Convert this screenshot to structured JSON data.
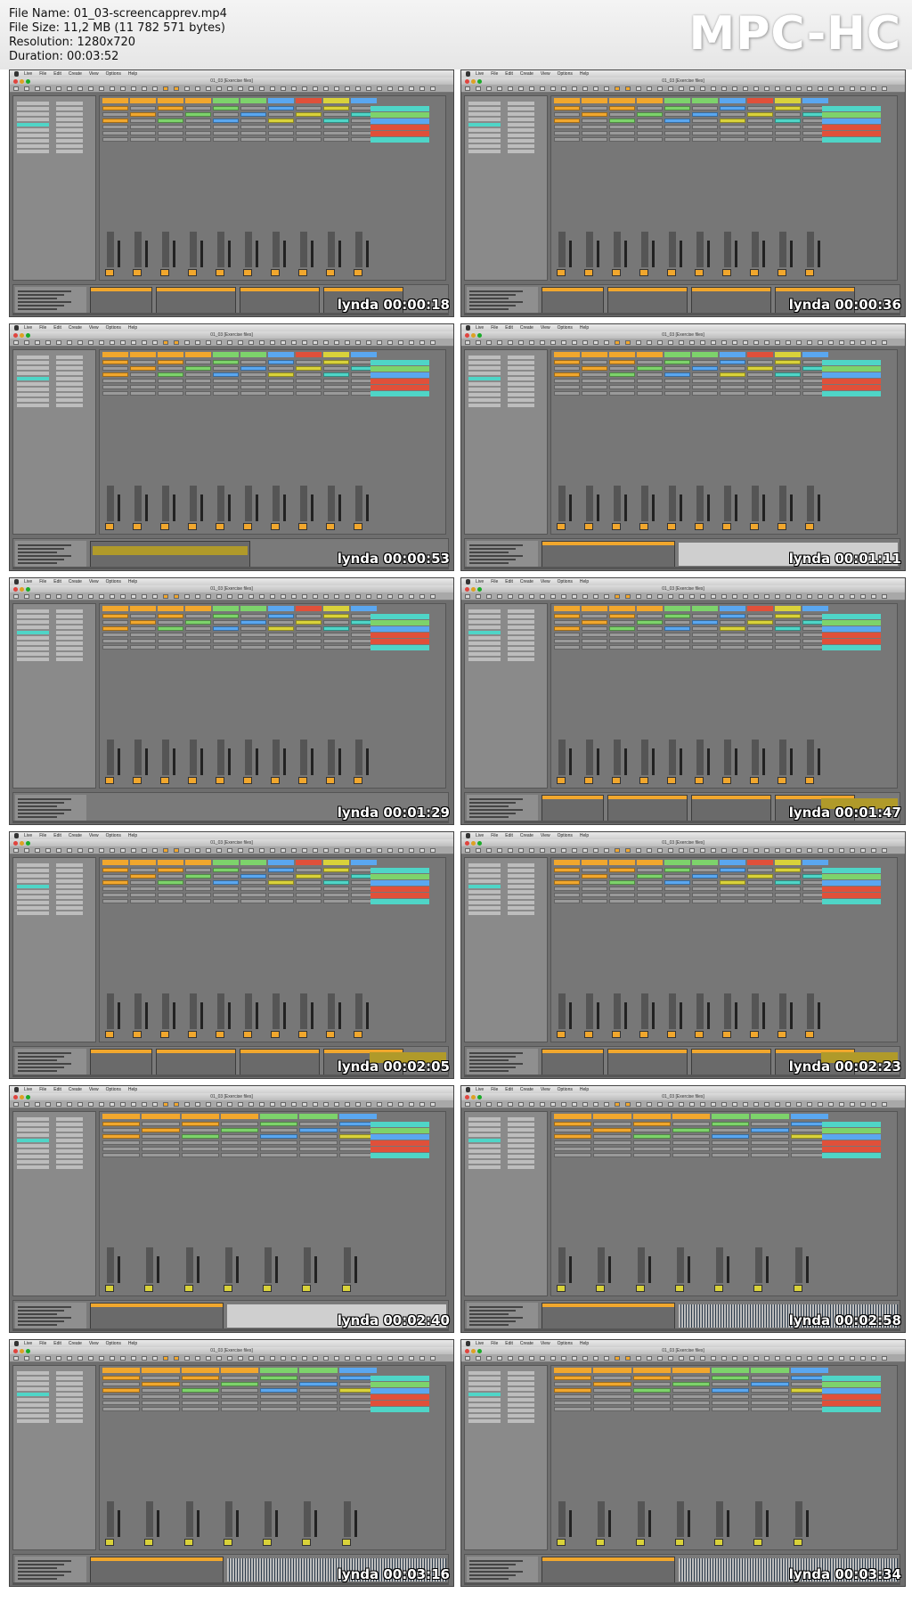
{
  "file_info": {
    "name": "File Name: 01_03-screencapprev.mp4",
    "size": "File Size: 11,2 MB (11 782 571 bytes)",
    "resolution": "Resolution: 1280x720",
    "duration": "Duration: 00:03:52"
  },
  "logo": "MPC-HC",
  "app_menu": [
    "Live",
    "File",
    "Edit",
    "Create",
    "View",
    "Options",
    "Help"
  ],
  "window_title": "01_03 [Exercise files]",
  "thumbnails": [
    {
      "timestamp": "00:00:18",
      "watermark": "lynda",
      "variant": "devices"
    },
    {
      "timestamp": "00:00:36",
      "watermark": "lynda",
      "variant": "devices"
    },
    {
      "timestamp": "00:00:53",
      "watermark": "lynda",
      "variant": "sampler"
    },
    {
      "timestamp": "00:01:11",
      "watermark": "lynda",
      "variant": "clip"
    },
    {
      "timestamp": "00:01:29",
      "watermark": "lynda",
      "variant": "empty"
    },
    {
      "timestamp": "00:01:47",
      "watermark": "lynda",
      "variant": "rack"
    },
    {
      "timestamp": "00:02:05",
      "watermark": "lynda",
      "variant": "rack"
    },
    {
      "timestamp": "00:02:23",
      "watermark": "lynda",
      "variant": "rack"
    },
    {
      "timestamp": "00:02:40",
      "watermark": "lynda",
      "variant": "clip"
    },
    {
      "timestamp": "00:02:58",
      "watermark": "lynda",
      "variant": "audio"
    },
    {
      "timestamp": "00:03:16",
      "watermark": "lynda",
      "variant": "audio"
    },
    {
      "timestamp": "00:03:34",
      "watermark": "lynda",
      "variant": "audio"
    }
  ],
  "colors": {
    "track_orange": "#f1a72d",
    "track_cyan": "#4fd5c7",
    "track_green": "#7dd36b",
    "track_blue": "#5aa7f0",
    "track_red": "#e0503a",
    "track_yellow": "#d9d23a"
  }
}
